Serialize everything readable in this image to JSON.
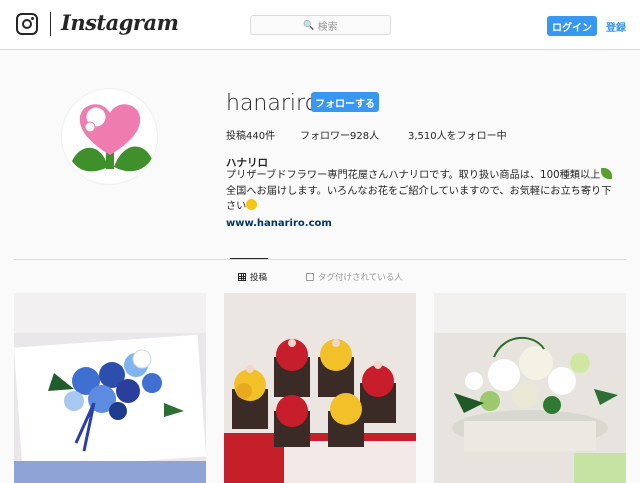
{
  "header": {
    "brand": "Instagram",
    "search_placeholder": "検索",
    "login_label": "ログイン",
    "signup_label": "登録"
  },
  "profile": {
    "username": "hanariro",
    "follow_label": "フォローする",
    "stats": {
      "posts": "投稿440件",
      "followers": "フォロワー928人",
      "following": "3,510人をフォロー中"
    },
    "full_name": "ハナリロ",
    "bio_line1": "プリザーブドフラワー専門花屋さんハナリロです。取り扱い商品は、100種類以上",
    "bio_line2": "全国へお届けします。いろんなお花をご紹介していますので、お気軽にお立ち寄り下",
    "bio_line3": "さい",
    "website": "www.hanariro.com"
  },
  "tabs": [
    {
      "label": "投稿",
      "icon": "grid-icon",
      "active": true
    },
    {
      "label": "タグ付けされている人",
      "icon": "tag-icon",
      "active": false
    }
  ],
  "posts": [
    {
      "icon": "blue-rose-frame-photo"
    },
    {
      "icon": "red-yellow-rose-pots-photo"
    },
    {
      "icon": "white-green-flower-basket-photo"
    }
  ],
  "colors": {
    "accent": "#3897f0",
    "link": "#003569",
    "background": "#fafafa",
    "heart_pink": "#ee7cae",
    "leaf_green": "#3f8f2a"
  }
}
